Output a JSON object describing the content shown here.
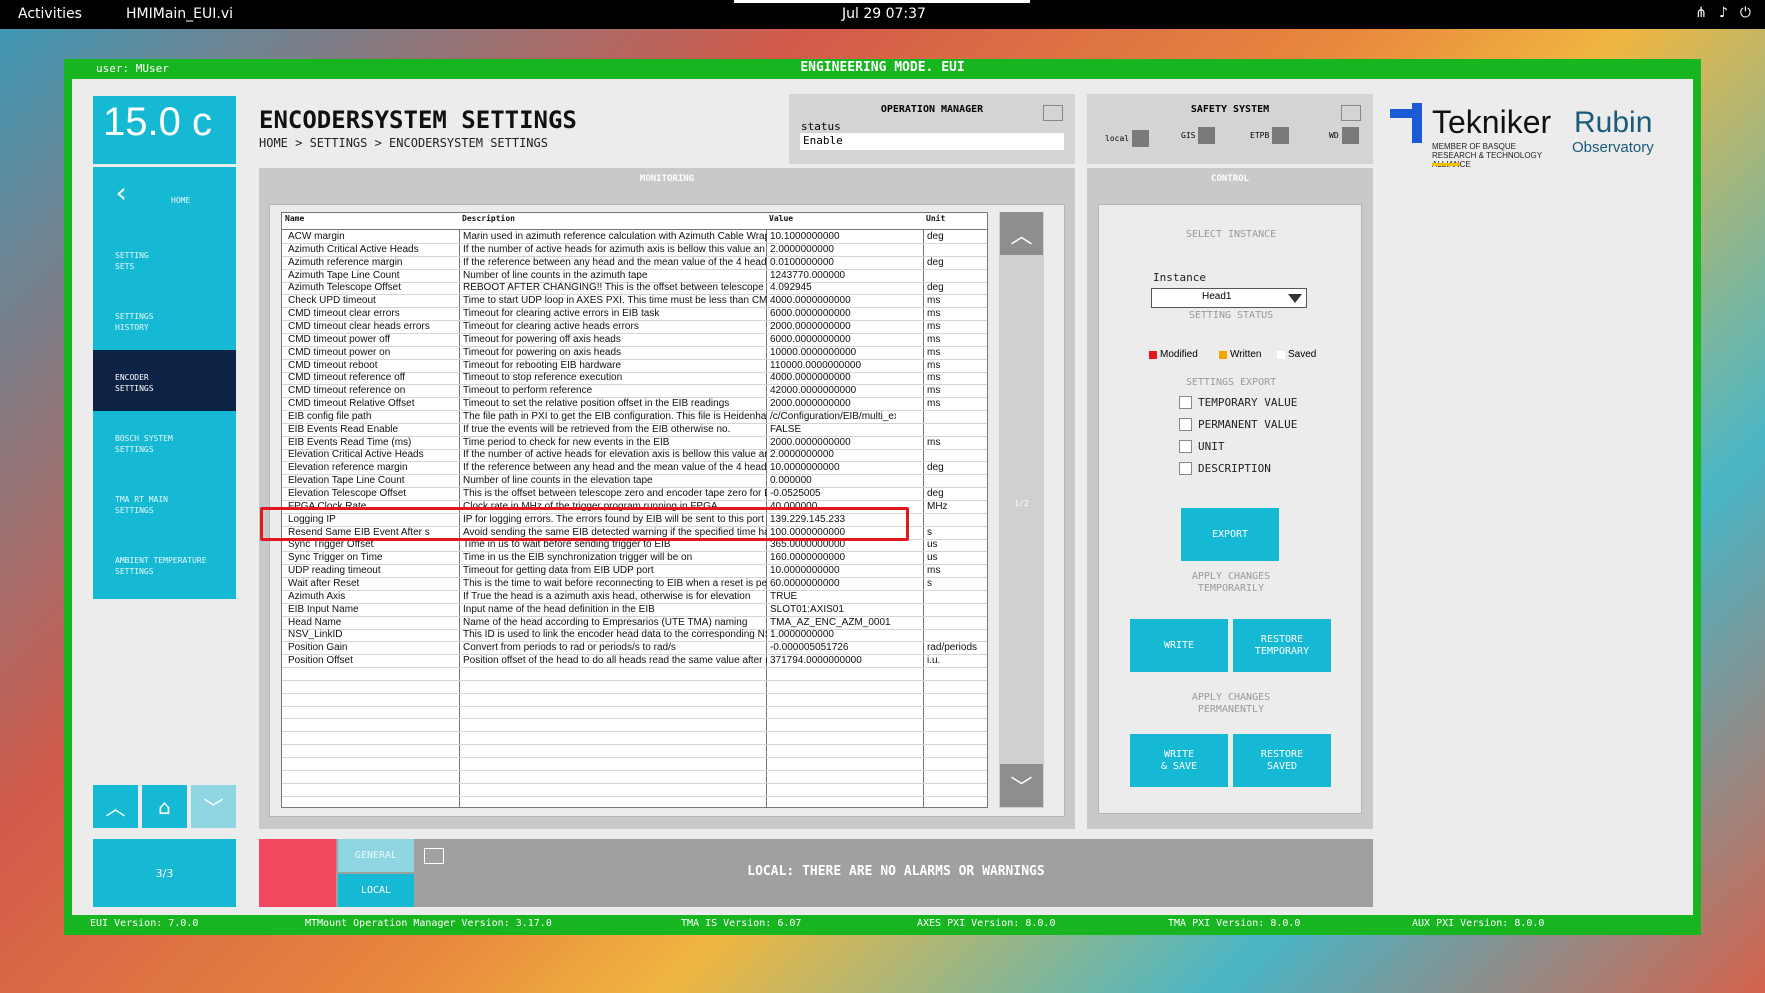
{
  "topbar": {
    "activities": "Activities",
    "app": "HMIMain_EUI.vi",
    "clock": "Jul 29  07:37"
  },
  "header": {
    "mode": "ENGINEERING MODE. EUI",
    "user": "user: MUser"
  },
  "temperature": "15.0 c",
  "nav": {
    "home": "HOME",
    "setting_sets": "SETTING\nSETS",
    "settings_history": "SETTINGS\nHISTORY",
    "encoder_settings": "ENCODER\nSETTINGS",
    "bosch_settings": "BOSCH SYSTEM\nSETTINGS",
    "tma_rt_settings": "TMA RT MAIN\nSETTINGS",
    "ambient_settings": "AMBIENT TEMPERATURE\nSETTINGS",
    "page": "3/3"
  },
  "page": {
    "title": "ENCODERSYSTEM SETTINGS",
    "breadcrumb": "HOME > SETTINGS > ENCODERSYSTEM SETTINGS"
  },
  "operation_manager": {
    "title": "OPERATION MANAGER",
    "status_label": "status",
    "status_value": "Enable"
  },
  "safety": {
    "title": "SAFETY SYSTEM",
    "indicators": [
      "local",
      "GIS",
      "ETPB",
      "WD"
    ]
  },
  "logos": {
    "tekniker": "Tekniker",
    "tekniker_sub": "MEMBER OF BASQUE RESEARCH & TECHNOLOGY ALLIANCE",
    "rubin": "Rubin",
    "observatory": "Observatory"
  },
  "monitoring": {
    "title": "MONITORING",
    "columns": [
      "Name",
      "Description",
      "Value",
      "Unit"
    ],
    "page_indicator": "1/2",
    "rows": [
      [
        "ACW margin",
        "Marin used in azimuth reference calculation with Azimuth Cable Wrap",
        "10.1000000000",
        "deg"
      ],
      [
        "Azimuth Critical Active Heads",
        "If the number of active heads for azimuth axis is bellow this value an a",
        "2.0000000000",
        ""
      ],
      [
        "Azimuth reference margin",
        "If the reference between any head and the mean value of the 4 heads",
        "0.0100000000",
        "deg"
      ],
      [
        "Azimuth Tape Line Count",
        "Number of line counts in the azimuth tape",
        "1243770.000000",
        ""
      ],
      [
        "Azimuth Telescope Offset",
        "REBOOT AFTER CHANGING!! This is the offset between telescope z",
        "4.092945",
        "deg"
      ],
      [
        "Check UPD timeout",
        "Time to start UDP loop in AXES PXI. This time must be less than CMD",
        "4000.0000000000",
        "ms"
      ],
      [
        "CMD timeout clear errors",
        "Timeout for  clearing active errors in EIB task",
        "6000.0000000000",
        "ms"
      ],
      [
        "CMD timeout clear heads errors",
        "Timeout for  clearing active heads errors",
        "2000.0000000000",
        "ms"
      ],
      [
        "CMD timeout power off",
        "Timeout for  powering off axis heads",
        "6000.0000000000",
        "ms"
      ],
      [
        "CMD timeout power on",
        "Timeout for  powering on axis heads",
        "10000.0000000000",
        "ms"
      ],
      [
        "CMD timeout reboot",
        "Timeout for rebooting EIB hardware",
        "110000.0000000000",
        "ms"
      ],
      [
        "CMD timeout reference off",
        "Timeout to stop reference execution",
        "4000.0000000000",
        "ms"
      ],
      [
        "CMD timeout reference on",
        "Timeout to perform reference",
        "42000.0000000000",
        "ms"
      ],
      [
        "CMD timeout Relative Offset",
        "Timeout to set the relative position offset in the EIB readings",
        "2000.0000000000",
        "ms"
      ],
      [
        "EIB config file path",
        "The file path in PXI to get the EIB configuration. This file is Heidenhain",
        "/c/Configuration/EIB/multi_ex",
        ""
      ],
      [
        "EIB Events Read Enable",
        "If true the events will be retrieved from the EIB otherwise no.",
        "FALSE",
        ""
      ],
      [
        "EIB Events Read Time (ms)",
        "Time period to check for new events in the EIB",
        "2000.0000000000",
        "ms"
      ],
      [
        "Elevation Critical Active Heads",
        "If the number of active heads for elevation axis is bellow this value an",
        "2.0000000000",
        ""
      ],
      [
        "Elevation reference margin",
        "If the reference between any head and the mean value of the 4 heads",
        "10.0000000000",
        "deg"
      ],
      [
        "Elevation Tape Line Count",
        "Number of line counts in the elevation tape",
        "0.000000",
        ""
      ],
      [
        "Elevation Telescope Offset",
        "This is the offset between telescope zero and encoder tape zero for El",
        "-0.0525005",
        "deg"
      ],
      [
        "FPGA Clock Rate",
        "Clock rate in MHz of the trigger program running in FPGA",
        "40.000000",
        "MHz"
      ],
      [
        "Logging IP",
        "IP for logging errors. The errors found by EIB will be sent to this port",
        "139.229.145.233",
        ""
      ],
      [
        "Resend Same EIB Event After s",
        "Avoid sending the same EIB detected warning if the specified time has",
        "100.0000000000",
        "s"
      ],
      [
        "Sync Trigger Offset",
        "Time in us to wait before sending trigger to EIB",
        "365.0000000000",
        "us"
      ],
      [
        "Sync Trigger on Time",
        "Time in us the EIB synchronization trigger will be on",
        "160.0000000000",
        "us"
      ],
      [
        "UDP reading timeout",
        "Timeout for getting data from EIB UDP port",
        "10.0000000000",
        "ms"
      ],
      [
        "Wait after Reset",
        "This is the time to wait before reconnecting to EIB when a reset is perf",
        "60.0000000000",
        "s"
      ],
      [
        "Azimuth Axis",
        "If True the head is a azimuth axis head, otherwise is for elevation",
        "TRUE",
        ""
      ],
      [
        "EIB Input Name",
        "Input name of the head definition in the EIB",
        "SLOT01:AXIS01",
        ""
      ],
      [
        "Head Name",
        "Name of the head according to Empresarios (UTE TMA) naming",
        "TMA_AZ_ENC_AZM_0001",
        ""
      ],
      [
        "NSV_LinkID",
        "This ID is used to link the encoder head data to the corresponding NS",
        "1.0000000000",
        ""
      ],
      [
        "Position Gain",
        "Convert from periods to rad or periods/s to rad/s",
        "-0.000005051726",
        "rad/periods"
      ],
      [
        "Position Offset",
        "Position offset of the head to do all heads read the same value after re",
        "371794.0000000000",
        "i.u."
      ]
    ]
  },
  "control": {
    "title": "CONTROL",
    "select_instance": "SELECT INSTANCE",
    "instance_label": "Instance",
    "instance_value": "Head1",
    "setting_status": "SETTING STATUS",
    "legend": [
      {
        "label": "Modified",
        "color": "#e8141c"
      },
      {
        "label": "Written",
        "color": "#f5a400"
      },
      {
        "label": "Saved",
        "color": "#ffffff"
      }
    ],
    "settings_export": "SETTINGS EXPORT",
    "export_options": [
      "TEMPORARY VALUE",
      "PERMANENT VALUE",
      "UNIT",
      "DESCRIPTION"
    ],
    "export_btn": "EXPORT",
    "apply_temp": "APPLY CHANGES\nTEMPORARILY",
    "write": "WRITE",
    "restore_temp": "RESTORE\nTEMPORARY",
    "apply_perm": "APPLY CHANGES\nPERMANENTLY",
    "write_save": "WRITE\n& SAVE",
    "restore_saved": "RESTORE\nSAVED"
  },
  "alarms": {
    "general": "GENERAL",
    "local": "LOCAL",
    "message": "LOCAL: THERE ARE NO ALARMS OR WARNINGS"
  },
  "versions": [
    "EUI Version: 7.0.0",
    "MTMount Operation Manager Version: 3.17.0",
    "TMA IS Version: 6.07",
    "AXES PXI Version: 8.0.0",
    "TMA PXI Version: 8.0.0",
    "AUX PXI Version: 8.0.0"
  ]
}
